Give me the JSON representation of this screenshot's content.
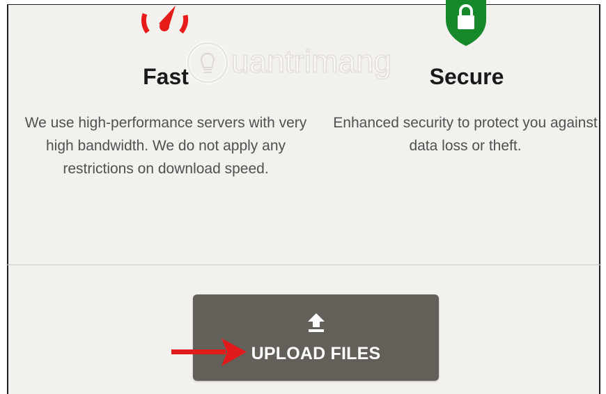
{
  "features": {
    "fast": {
      "title": "Fast",
      "description": "We use high-performance servers with very high bandwidth. We do not apply any restrictions on download speed.",
      "icon": "speedometer-icon",
      "icon_color": "#e81b1b"
    },
    "secure": {
      "title": "Secure",
      "description": "Enhanced security to protect you against data loss or theft.",
      "icon": "lock-shield-icon",
      "icon_color": "#168a2b"
    }
  },
  "upload": {
    "label": "UPLOAD FILES",
    "icon": "upload-arrow-icon",
    "background": "#635f59"
  },
  "annotation": {
    "icon": "red-pointer-arrow",
    "color": "#e11a1a"
  },
  "watermark": {
    "text": "uantrimang",
    "icon": "lightbulb-icon"
  }
}
